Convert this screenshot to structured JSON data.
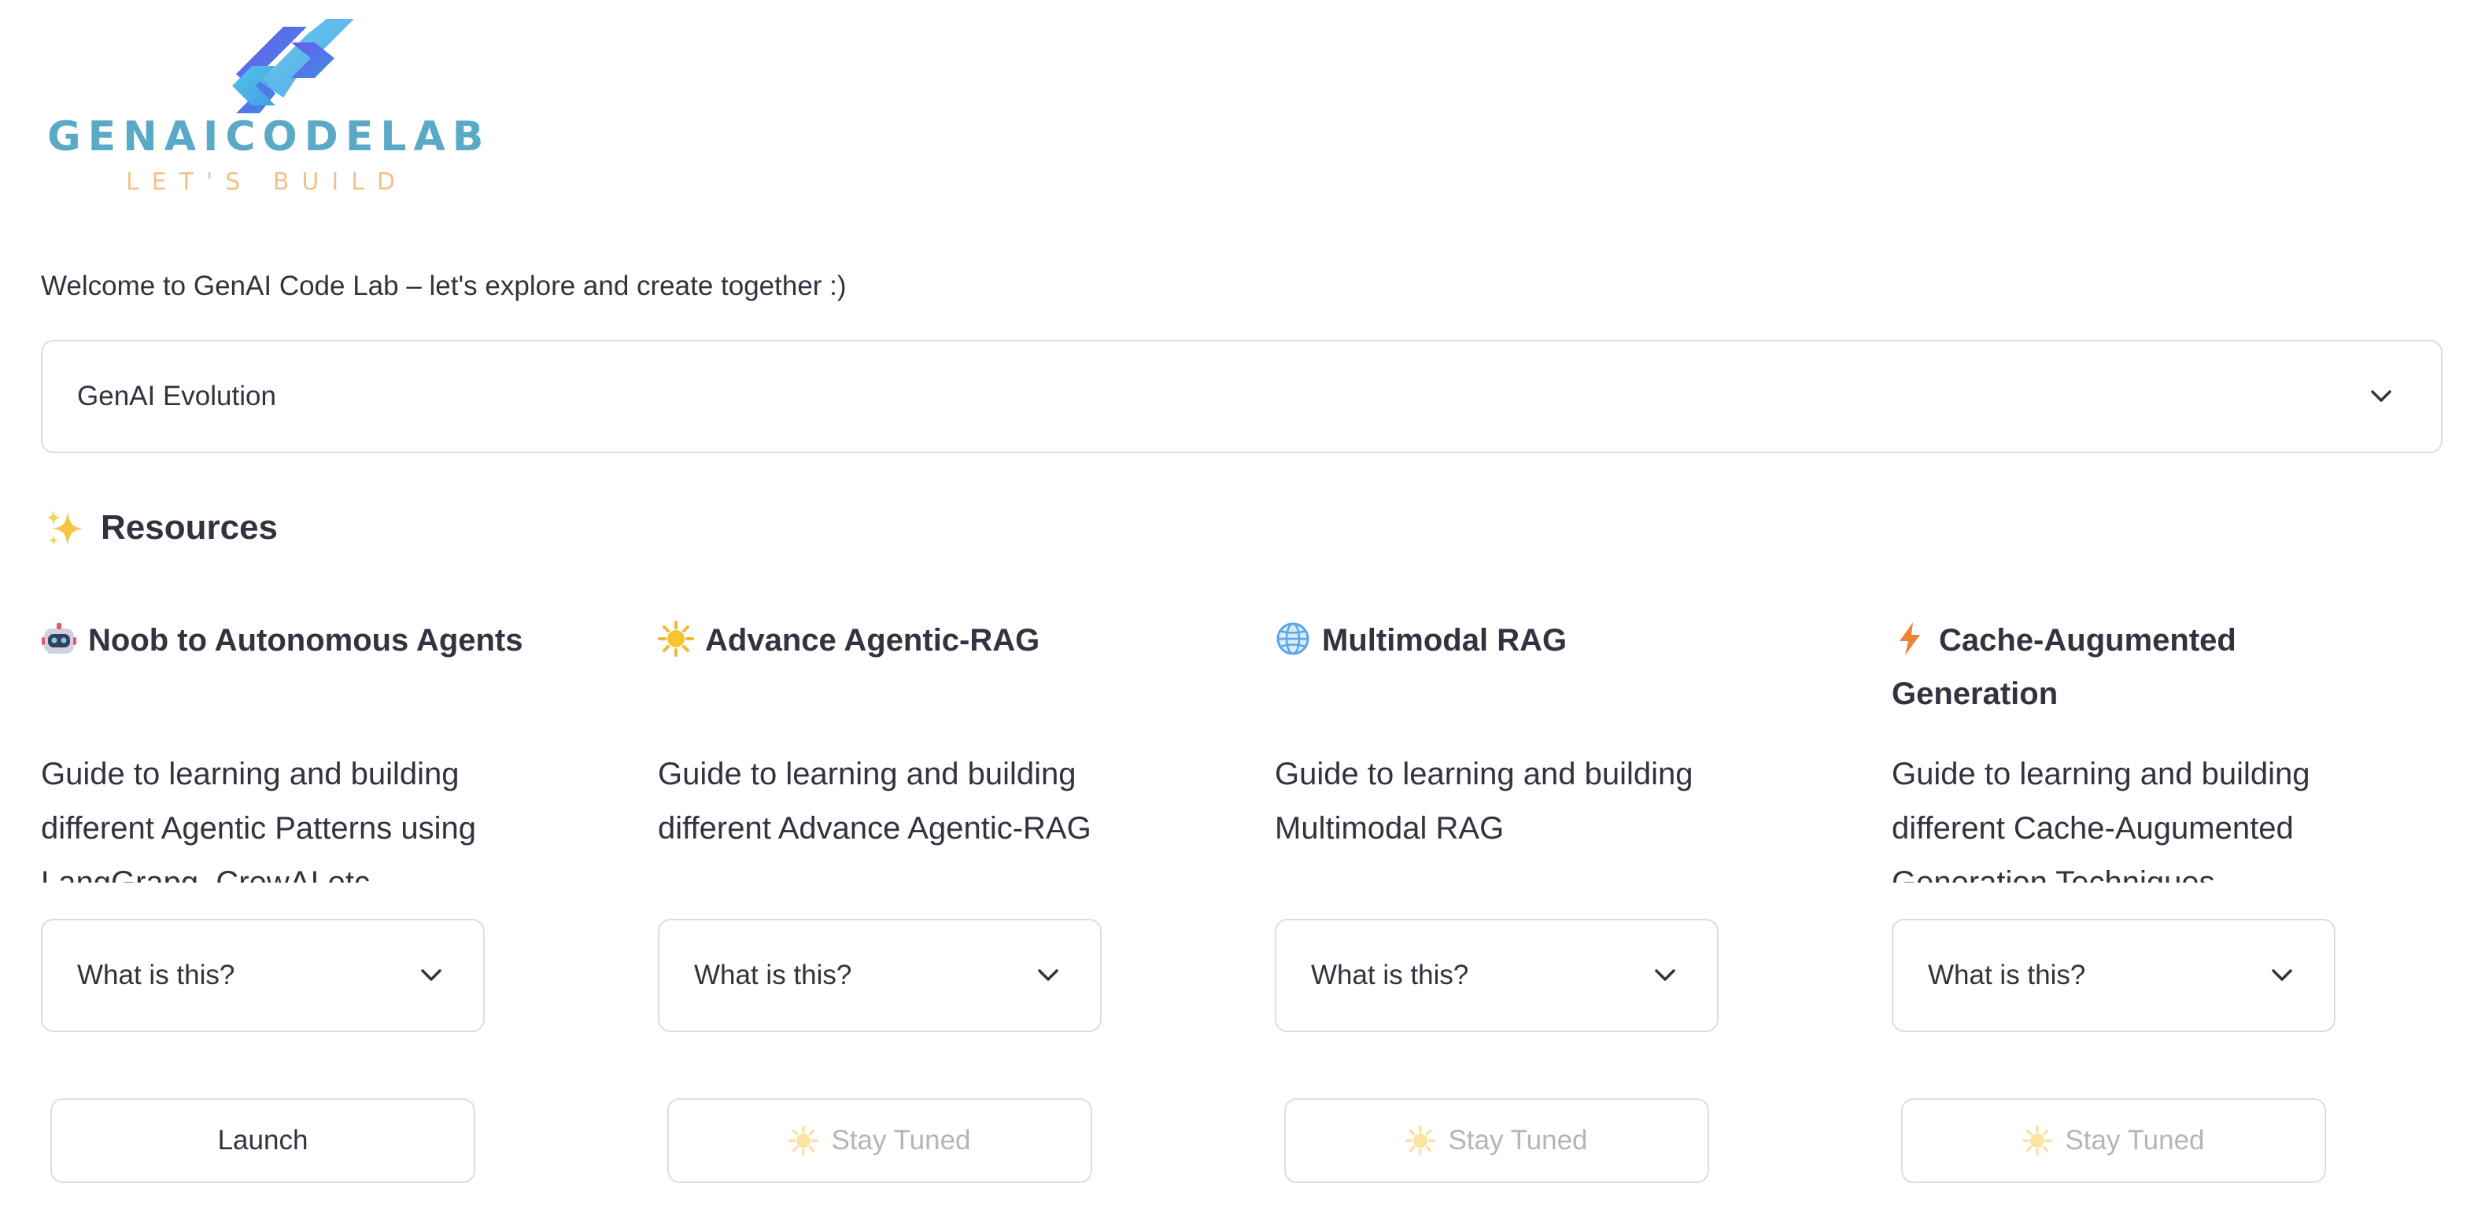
{
  "logo": {
    "title": "GENAICODELAB",
    "tagline": "LET'S BUILD"
  },
  "welcome": "Welcome to GenAI Code Lab – let's explore and create together :)",
  "top_expander": {
    "label": "GenAI Evolution"
  },
  "resources": {
    "heading": "Resources",
    "icon": "sparkles-icon"
  },
  "cards": [
    {
      "icon": "robot-icon",
      "title": "Noob to Autonomous Agents",
      "description": "Guide to learning and building different Agentic Patterns using LangGrapg, CrewAI etc",
      "expander_label": "What is this?",
      "button_label": "Launch",
      "button_enabled": true
    },
    {
      "icon": "sun-icon",
      "title": "Advance Agentic-RAG",
      "description": "Guide to learning and building different Advance Agentic-RAG",
      "expander_label": "What is this?",
      "button_label": "Stay Tuned",
      "button_icon": "sun-icon",
      "button_enabled": false
    },
    {
      "icon": "globe-icon",
      "title": "Multimodal RAG",
      "description": "Guide to learning and building Multimodal RAG",
      "expander_label": "What is this?",
      "button_label": "Stay Tuned",
      "button_icon": "sun-icon",
      "button_enabled": false
    },
    {
      "icon": "lightning-icon",
      "title": "Cache-Augumented Generation",
      "description": "Guide to learning and building different Cache-Augumented Generation Techniques",
      "expander_label": "What is this?",
      "button_label": "Stay Tuned",
      "button_icon": "sun-icon",
      "button_enabled": false
    }
  ],
  "colors": {
    "text": "#31333f",
    "border": "#dcdde2",
    "disabled_text": "#b3b5bd",
    "logo_primary": "#5aa9c7",
    "logo_accent": "#f2c08a"
  }
}
